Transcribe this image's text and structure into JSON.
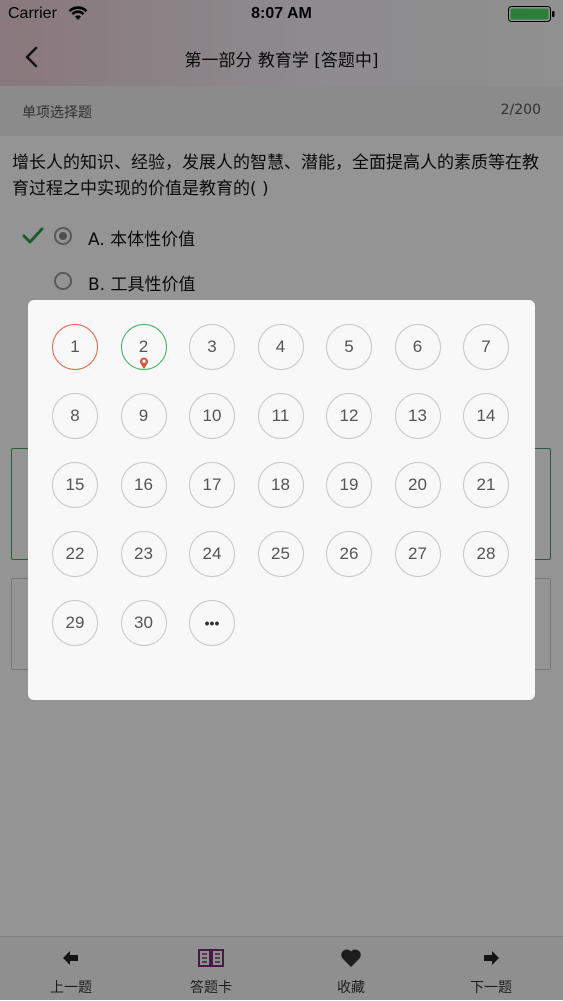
{
  "status_bar": {
    "carrier": "Carrier",
    "time": "8:07 AM"
  },
  "nav": {
    "title": "第一部分 教育学 [答题中]"
  },
  "question": {
    "type": "单项选择题",
    "progress": "2/200",
    "text": "增长人的知识、经验，发展人的智慧、潜能，全面提高人的素质等在教育过程之中实现的价值是教育的(    )",
    "options": [
      {
        "label": "A. 本体性价值",
        "selected": true,
        "correct": true
      },
      {
        "label": "B. 工具性价值",
        "selected": false,
        "correct": false
      }
    ]
  },
  "answer_card": {
    "numbers": [
      "1",
      "2",
      "3",
      "4",
      "5",
      "6",
      "7",
      "8",
      "9",
      "10",
      "11",
      "12",
      "13",
      "14",
      "15",
      "16",
      "17",
      "18",
      "19",
      "20",
      "21",
      "22",
      "23",
      "24",
      "25",
      "26",
      "27",
      "28",
      "29",
      "30"
    ],
    "more_label": "•••",
    "wrong_item": "1",
    "current_item": "2"
  },
  "tab_bar": {
    "items": [
      {
        "label": "上一题",
        "icon": "arrow-left-icon"
      },
      {
        "label": "答题卡",
        "icon": "book-icon"
      },
      {
        "label": "收藏",
        "icon": "heart-icon"
      },
      {
        "label": "下一题",
        "icon": "arrow-right-icon"
      }
    ]
  },
  "colors": {
    "correct_green": "#3fb46b",
    "wrong_red": "#e0684f",
    "accent_purple": "#7a2e78",
    "marker_red": "#e0553f"
  }
}
